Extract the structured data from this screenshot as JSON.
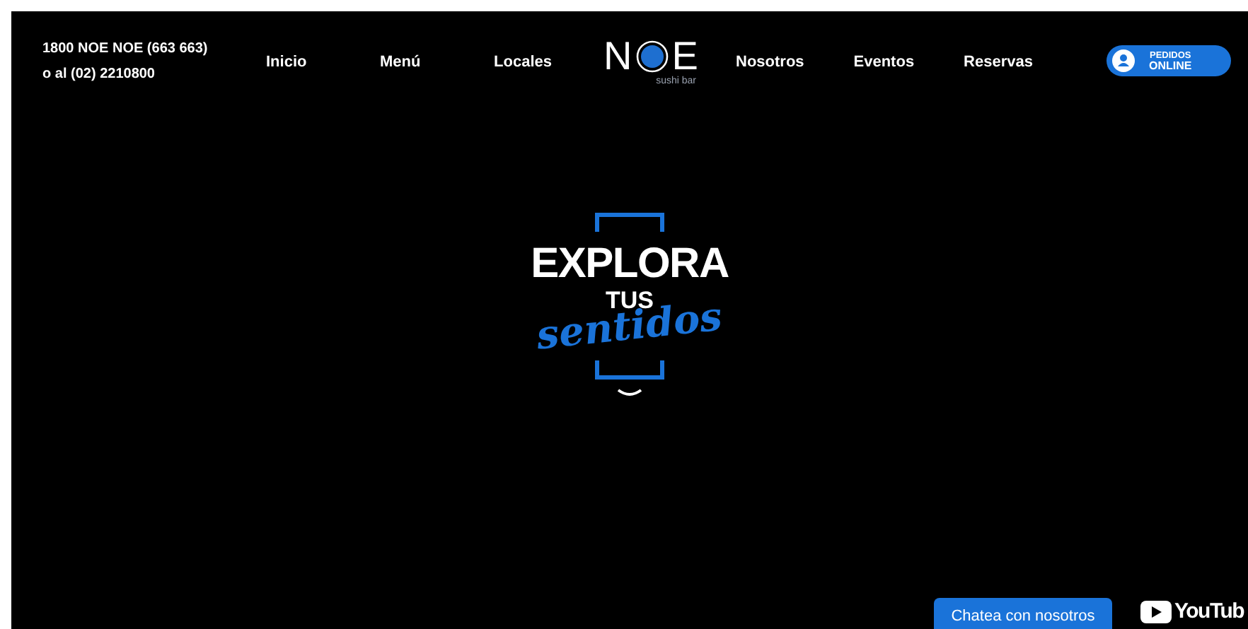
{
  "header": {
    "phone_lines": [
      "1800 NOE NOE (663 663)",
      "o al (02) 2210800"
    ],
    "nav_left": [
      "Inicio",
      "Menú",
      "Locales"
    ],
    "logo": {
      "letters_left": "N",
      "letters_right": "E",
      "tagline": "sushi bar"
    },
    "nav_right": [
      "Nosotros",
      "Eventos",
      "Reservas"
    ],
    "order_button": {
      "line_1": "PEDIDOS",
      "line_2": "ONLINE"
    }
  },
  "hero": {
    "line_1": "EXPLORA",
    "line_2": "TUS",
    "line_3": "sentidos"
  },
  "chat_button": "Chatea con nosotros",
  "youtube_label": "YouTub"
}
